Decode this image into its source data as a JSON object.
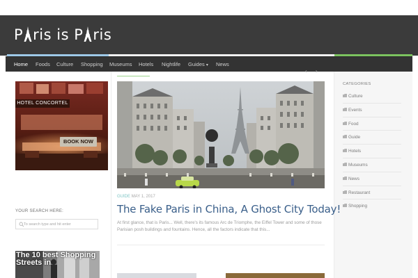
{
  "site": {
    "logo_text": "Paris is Paris",
    "logo_parts": [
      "P",
      "ris is P",
      "ris"
    ]
  },
  "colors": {
    "header_bg": "#3b3b3b",
    "nav_bg": "#333333",
    "accent_blue": "#9ec9e8",
    "accent_green": "#7cc35f",
    "title_blue": "#3a5f8a"
  },
  "nav": {
    "items": [
      {
        "label": "Home",
        "active": true
      },
      {
        "label": "Foods"
      },
      {
        "label": "Culture"
      },
      {
        "label": "Shopping"
      },
      {
        "label": "Museums"
      },
      {
        "label": "Hotels"
      },
      {
        "label": "Nightlife"
      },
      {
        "label": "Guides",
        "has_dropdown": true,
        "icon": "chevron-down-icon"
      },
      {
        "label": "News"
      }
    ]
  },
  "left": {
    "ad": {
      "hotel_name": "HOTEL CONCORTEL",
      "cta": "BOOK NOW"
    },
    "search": {
      "title": "YOUR SEARCH HERE:",
      "placeholder": "To search type and hit enter",
      "icon": "search-icon"
    },
    "thumb": {
      "text": "The 10 best Shopping Streets in"
    }
  },
  "post": {
    "category": "GUIDE",
    "date": "MAY 1, 2017",
    "title": "The Fake Paris in China, A Ghost City Today!",
    "excerpt": "At first glance, that is Paris... Well, there's its famous Arc de Triomphe, the Eiffel Tower and some of those Parisian posh buildings and fountains. Hence, all the factors indicate that this..."
  },
  "slider": {
    "prev": "‹",
    "next": "›"
  },
  "sidebar": {
    "title": "CATEGORIES",
    "icon": "folder-icon",
    "items": [
      "Culture",
      "Events",
      "Food",
      "Guide",
      "Hotels",
      "Museums",
      "News",
      "Restaurant",
      "Shopping"
    ]
  }
}
